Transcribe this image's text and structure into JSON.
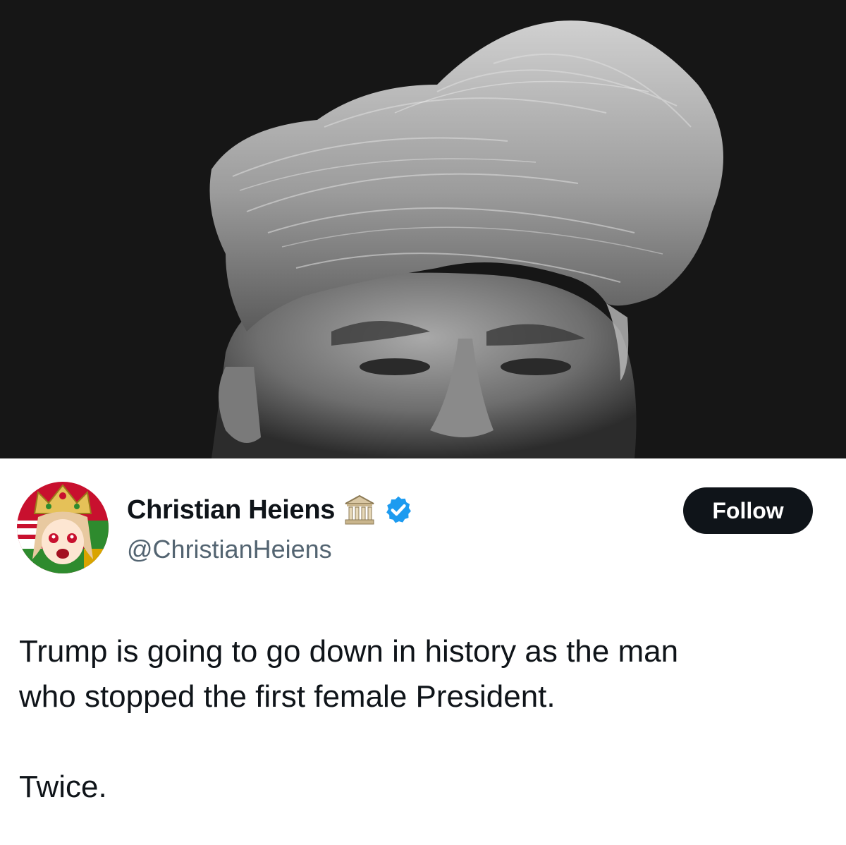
{
  "post": {
    "image": {
      "icon": "portrait-photo",
      "background_color": "#161616",
      "tone": "grayscale"
    },
    "author": {
      "display_name": "Christian Heiens",
      "handle": "@ChristianHeiens",
      "name_emoji": "classical-building-icon",
      "verified": true,
      "verified_color": "#1d9bf0",
      "avatar_icon": "anime-avatar-with-crown"
    },
    "follow_button": {
      "label": "Follow",
      "background_color": "#0f1419",
      "text_color": "#ffffff"
    },
    "text": {
      "line1": "Trump is going to go down in history as the man",
      "line2": "who stopped the first female President.",
      "line3": "Twice."
    }
  }
}
